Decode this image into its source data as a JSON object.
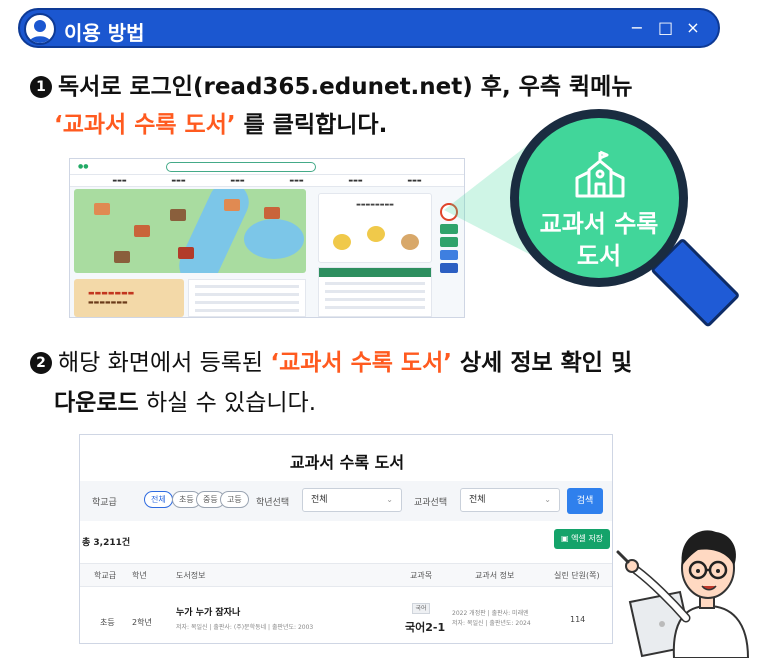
{
  "window": {
    "title": "이용 방법",
    "controls": [
      "−",
      "□",
      "×"
    ]
  },
  "step1": {
    "number": "1",
    "line1": "독서로 로그인(read365.edunet.net) 후, 우측 퀵메뉴",
    "highlight": "‘교과서 수록 도서’",
    "line2_rest": " 를 클릭합니다."
  },
  "magnifier": {
    "line1": "교과서 수록",
    "line2": "도서"
  },
  "step2": {
    "number": "2",
    "line1_pre": "해당 화면에서 등록된 ",
    "highlight": "‘교과서 수록 도서’",
    "line1_post": " 상세 정보 확인 및",
    "line2_bold": "다운로드",
    "line2_rest": " 하실 수 있습니다."
  },
  "screenshot2": {
    "title": "교과서 수록 도서",
    "school_label": "학교급",
    "school_pills": [
      "전체",
      "초등",
      "중등",
      "고등"
    ],
    "grade_label": "학년선택",
    "grade_value": "전체",
    "textbook_label": "교과선택",
    "textbook_value": "전체",
    "search_button": "검색",
    "total": "총 3,211건",
    "excel_button": "엑셀 저장",
    "columns": [
      "학교급",
      "학년",
      "도서정보",
      "교과목",
      "교과서 정보",
      "실린 단원(쪽)"
    ],
    "row": {
      "school": "초등",
      "grade": "2학년",
      "book_title": "누가 누가 잠자나",
      "book_meta": "저자: 목일신 | 출판사: (주)문학동네 | 출판년도: 2003",
      "subject_badge": "국어",
      "subject": "국어2-1",
      "textbook_info_1": "2022 개정판 | 출판사: 미래엔",
      "textbook_info_2": "저자: 목일신 | 출판년도: 2024",
      "pages": "114"
    }
  },
  "colors": {
    "titlebar": "#1b57d0",
    "highlight": "#ff5a1f",
    "magnifier_lens": "#41d69a",
    "handle": "#1f5bd6",
    "excel": "#14a36a",
    "search": "#2f80ed"
  }
}
